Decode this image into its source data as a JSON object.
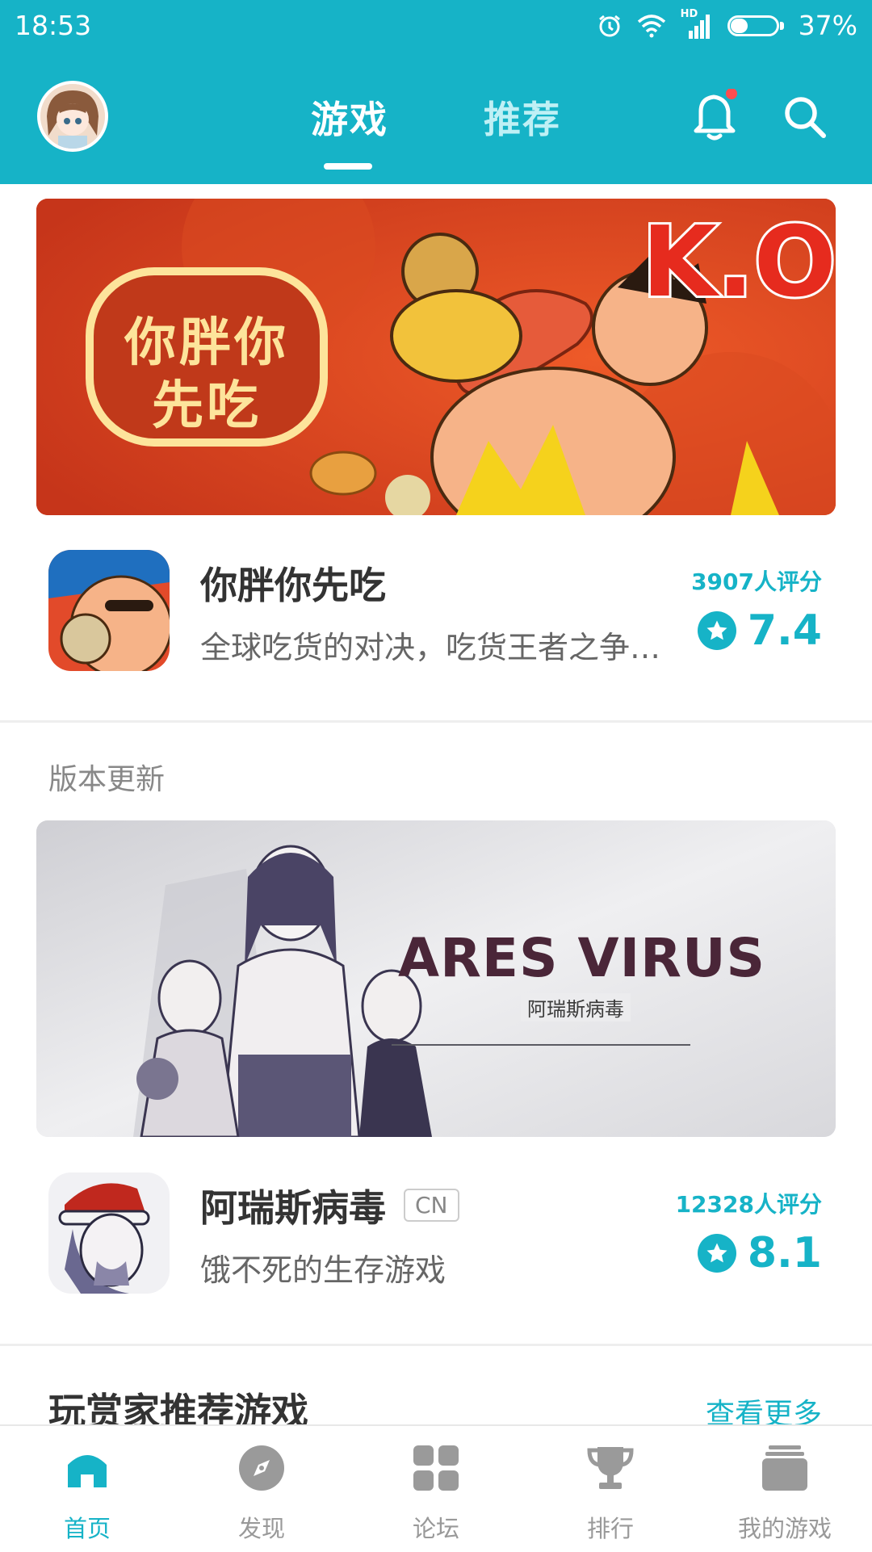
{
  "status_bar": {
    "time": "18:53",
    "network_label": "HD",
    "battery": "37%",
    "battery_level": 0.37
  },
  "header": {
    "tabs": [
      {
        "label": "游戏",
        "active": true
      },
      {
        "label": "推荐",
        "active": false
      }
    ],
    "icons": [
      "avatar",
      "bell-icon",
      "search-icon"
    ],
    "notification_dot": true
  },
  "featured": {
    "banner_text": "你胖你先吃",
    "banner_ko": "K.O",
    "game": {
      "name": "你胖你先吃",
      "desc": "全球吃货的对决，吃货王者之争一...",
      "rating_count": "3907人评分",
      "score": "7.4"
    }
  },
  "version_update": {
    "section_label": "版本更新",
    "banner_title": "ARES VIRUS",
    "banner_subtitle": "阿瑞斯病毒",
    "game": {
      "name": "阿瑞斯病毒",
      "tag": "CN",
      "desc": "饿不死的生存游戏",
      "rating_count": "12328人评分",
      "score": "8.1"
    }
  },
  "recommend": {
    "title": "玩赏家推荐游戏",
    "more": "查看更多"
  },
  "bottom_nav": [
    {
      "label": "首页",
      "icon": "home-icon",
      "active": true
    },
    {
      "label": "发现",
      "icon": "compass-icon",
      "active": false
    },
    {
      "label": "论坛",
      "icon": "grid-icon",
      "active": false
    },
    {
      "label": "排行",
      "icon": "trophy-icon",
      "active": false
    },
    {
      "label": "我的游戏",
      "icon": "stack-icon",
      "active": false
    }
  ],
  "colors": {
    "accent": "#16b3c7",
    "banner1": "#d5411d",
    "banner2": "#e6e6e8",
    "notification": "#ff4d4f"
  }
}
